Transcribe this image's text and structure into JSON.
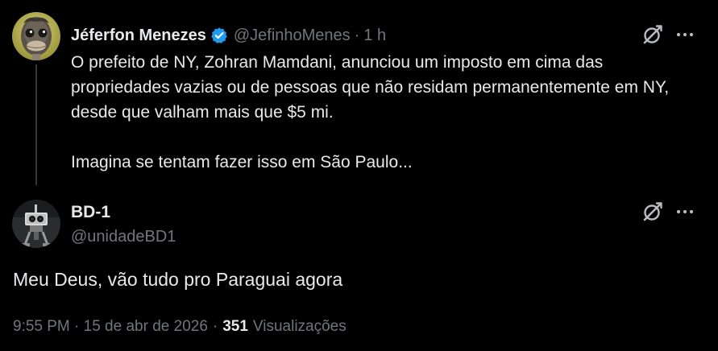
{
  "parent_tweet": {
    "author_name": "Jéferfon Menezes",
    "handle": "@JefinhoMenes",
    "separator": "·",
    "time_ago": "1 h",
    "paragraphs": [
      "O prefeito de NY, Zohran Mamdani, anunciou um imposto em cima das propriedades vazias ou de pessoas que não residam permanentemente em NY, desde que valham mais que $5 mi.",
      "Imagina se tentam fazer isso em São Paulo..."
    ],
    "avatar_icon": "ostrich-avatar",
    "verified_icon": "verified-badge-icon"
  },
  "reply_tweet": {
    "author_name": "BD-1",
    "handle": "@unidadeBD1",
    "text": "Meu Deus, vão tudo pro Paraguai agora",
    "avatar_icon": "robot-avatar",
    "timestamp": "9:55 PM · 15 de abr de 2026",
    "separator": "·",
    "views_count": "351",
    "views_label": "Visualizações"
  },
  "icons": {
    "grok": "grok-icon",
    "more": "more-icon"
  },
  "colors": {
    "background": "#000000",
    "primary_text": "#e7e9ea",
    "secondary_text": "#71767b",
    "verified": "#1d9bf0",
    "thread_line": "#333639"
  }
}
